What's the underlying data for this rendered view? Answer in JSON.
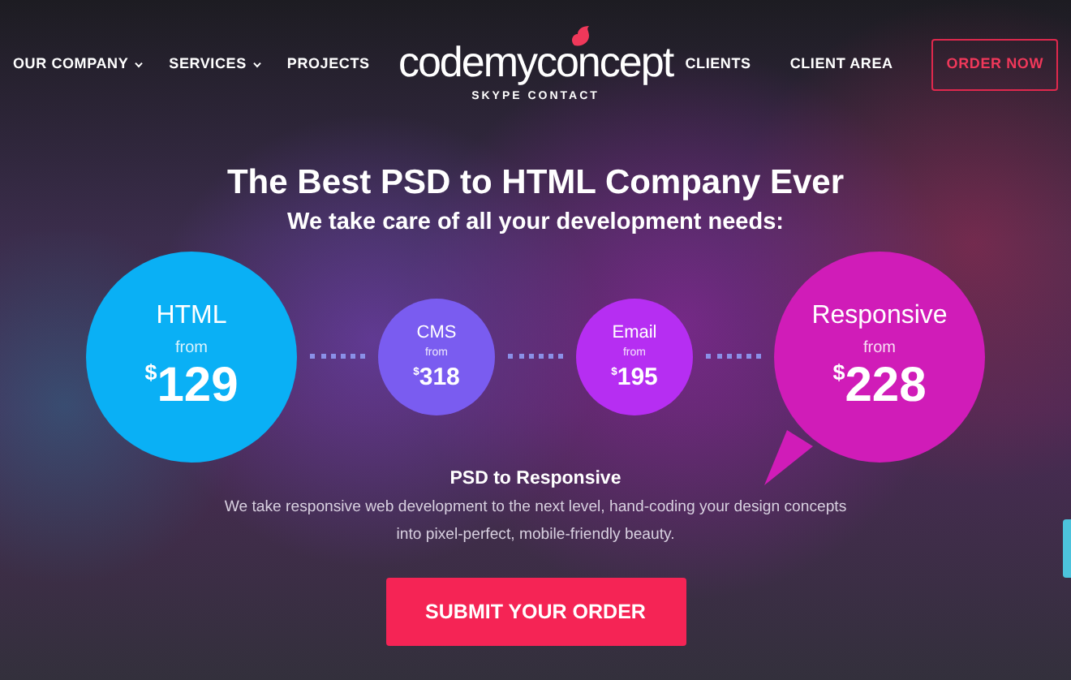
{
  "nav_left": [
    {
      "label": "OUR COMPANY",
      "dropdown": true
    },
    {
      "label": "SERVICES",
      "dropdown": true
    },
    {
      "label": "PROJECTS",
      "dropdown": false
    }
  ],
  "logo": {
    "text": "codemyconcept",
    "subtitle": "SKYPE CONTACT"
  },
  "nav_right": [
    {
      "label": "CLIENTS",
      "kind": "link"
    },
    {
      "label": "CLIENT AREA",
      "kind": "link"
    },
    {
      "label": "ORDER NOW",
      "kind": "outline"
    }
  ],
  "heading": "The Best PSD to HTML Company Ever",
  "subheading": "We take care of all your development needs:",
  "prices": [
    {
      "name": "HTML",
      "from": "from",
      "currency": "$",
      "amount": "129",
      "kind": "large",
      "color": "#0ab0f5"
    },
    {
      "name": "CMS",
      "from": "from",
      "currency": "$",
      "amount": "318",
      "kind": "small",
      "color": "#7a5cf0"
    },
    {
      "name": "Email",
      "from": "from",
      "currency": "$",
      "amount": "195",
      "kind": "small",
      "color": "#b62ef2"
    },
    {
      "name": "Responsive",
      "from": "from",
      "currency": "$",
      "amount": "228",
      "kind": "bubble",
      "color": "#d01cb8"
    }
  ],
  "detail": {
    "title": "PSD to Responsive",
    "text": "We take responsive web development to the next level, hand-coding your design concepts into pixel-perfect, mobile-friendly beauty."
  },
  "cta": "SUBMIT YOUR ORDER"
}
